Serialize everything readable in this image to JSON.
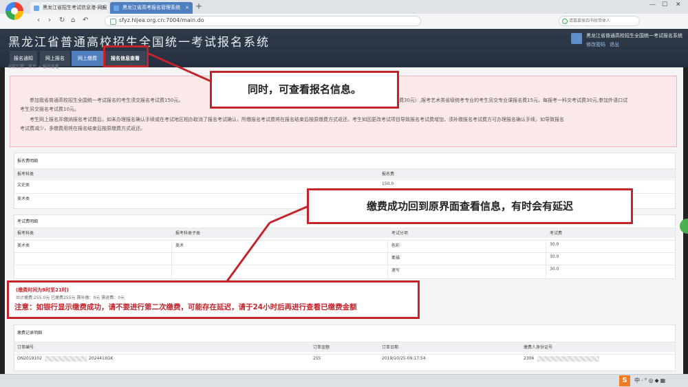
{
  "browser": {
    "tabs": [
      {
        "title": "黑龙江省招生考试信息港-网报"
      },
      {
        "title": "黑龙江省高考报名管理系统"
      }
    ],
    "new_tab": "+",
    "close": "×",
    "url": "sfyz.hljea.org.cn:7004/main.do",
    "search_placeholder": "请慕慕侯四书就带体人",
    "nav": {
      "back": "‹",
      "forward": "›",
      "reload": "↻",
      "home": "⌂",
      "undo": "↶"
    },
    "window_controls": {
      "min": "—",
      "max": "☐",
      "close": "✕"
    }
  },
  "site": {
    "title": "黑龙江省普通高校招生全国统一考试报名系统",
    "user": {
      "name": "黑龙江省普通高校招生全国统一考试报名系统",
      "modify_password": "修改密码",
      "logout": "退出"
    },
    "nav_tabs": [
      {
        "label": "报名通知"
      },
      {
        "label": "网上报名"
      },
      {
        "label": "网上缴费"
      },
      {
        "label": "报名信息查看"
      }
    ],
    "breadcrumb": "当前位置：首页 > 报名查看"
  },
  "notice": {
    "para1": "参加我省普通高校招生全国统一考试报名的考生须交报名考试费150元。",
    "para1_tail": "费30元）,报考艺术类省级统考专业的考生另交专业课报名费15元，每报考一科交考试费30元,参加外语口试",
    "para2": "考生另交报名考试费10元。",
    "para3": "考生网上报名并缴纳报名考试费后，如未办理报名确认手续或在考试地区相办取消了报名考试确认，所缴报名考试费将在报名结束后按原缴费方式返还。考生如因更改考试项目导致报名考试费增加，须补缴报名考试费方可办理报名确认手续，如导致报名",
    "para4": "考试费减少，多缴费用将在报名结束后按原缴费方式返还。"
  },
  "fee_detail": {
    "title": "报名费明细",
    "headers": [
      "报考科类",
      "报名费"
    ],
    "rows": [
      {
        "category": "文史类",
        "fee": "150.0"
      },
      {
        "category": "美术类",
        "fee": ""
      }
    ]
  },
  "exam_detail": {
    "title": "考试费明细",
    "headers": [
      "报考科类",
      "报考科类子类",
      "考试分项",
      "考试费"
    ],
    "rows": [
      {
        "category": "美术类",
        "subcategory": "美术",
        "item": "色彩",
        "fee": "30.0"
      },
      {
        "category": "",
        "subcategory": "",
        "item": "素描",
        "fee": "30.0"
      },
      {
        "category": "",
        "subcategory": "",
        "item": "速写",
        "fee": "30.0"
      }
    ]
  },
  "payment": {
    "time": "(缴费时间为9时至21时)",
    "summary": "共计缴费:255.0元 已缴费255元 需补缴：0元 需退费：0元",
    "warning": "注意：如银行显示缴费成功，请不要进行第二次缴费，可能存在延迟，请于24小时后再进行查看已缴费金额"
  },
  "pay_records": {
    "title": "缴费记录明细",
    "headers": [
      "订单编号",
      "订单金额",
      "订单日期",
      "缴费人身份证号"
    ],
    "rows": [
      {
        "order_no": "ON2019102",
        "order_no_tail": "202441XGK",
        "amount": "255",
        "date": "2019/10/25-09:17:54",
        "id_no": "2306"
      }
    ]
  },
  "annotations": {
    "box1": "同时，可查看报名信息。",
    "box2": "缴费成功回到原界面查看信息，有时会有延迟",
    "color": "#c3242b"
  },
  "taskbar": {
    "ime": "S",
    "tray": "中·°◎◆▦"
  }
}
